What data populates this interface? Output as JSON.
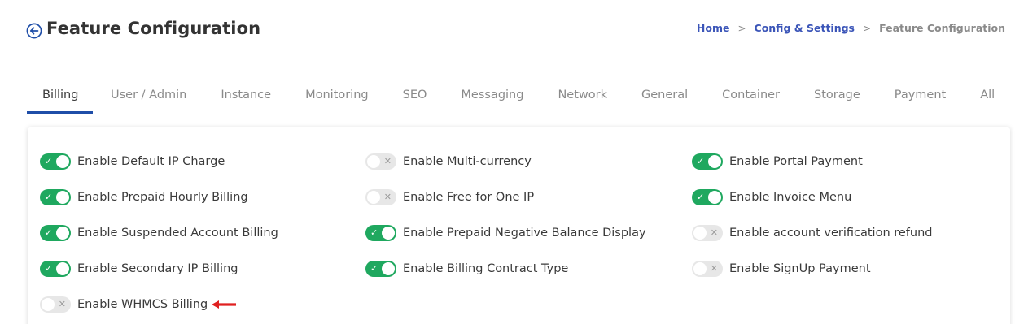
{
  "header": {
    "title": "Feature Configuration",
    "breadcrumb": {
      "home": "Home",
      "section": "Config & Settings",
      "current": "Feature Configuration",
      "separator": ">"
    }
  },
  "tabs": [
    {
      "label": "Billing",
      "active": true
    },
    {
      "label": "User / Admin",
      "active": false
    },
    {
      "label": "Instance",
      "active": false
    },
    {
      "label": "Monitoring",
      "active": false
    },
    {
      "label": "SEO",
      "active": false
    },
    {
      "label": "Messaging",
      "active": false
    },
    {
      "label": "Network",
      "active": false
    },
    {
      "label": "General",
      "active": false
    },
    {
      "label": "Container",
      "active": false
    },
    {
      "label": "Storage",
      "active": false
    },
    {
      "label": "Payment",
      "active": false
    },
    {
      "label": "All",
      "active": false
    }
  ],
  "settings": {
    "col1": [
      {
        "label": "Enable Default IP Charge",
        "enabled": true
      },
      {
        "label": "Enable Prepaid Hourly Billing",
        "enabled": true
      },
      {
        "label": "Enable Suspended Account Billing",
        "enabled": true
      },
      {
        "label": "Enable Secondary IP Billing",
        "enabled": true
      },
      {
        "label": "Enable WHMCS Billing",
        "enabled": false
      }
    ],
    "col2": [
      {
        "label": "Enable Multi-currency",
        "enabled": false
      },
      {
        "label": "Enable Free for One IP",
        "enabled": false
      },
      {
        "label": "Enable Prepaid Negative Balance Display",
        "enabled": true
      },
      {
        "label": "Enable Billing Contract Type",
        "enabled": true
      }
    ],
    "col3": [
      {
        "label": "Enable Portal Payment",
        "enabled": true
      },
      {
        "label": "Enable Invoice Menu",
        "enabled": true
      },
      {
        "label": "Enable account verification refund",
        "enabled": false
      },
      {
        "label": "Enable SignUp Payment",
        "enabled": false
      }
    ]
  },
  "toggle_marks": {
    "on": "✓",
    "off": "✕"
  },
  "colors": {
    "toggle_on": "#1fa85f",
    "toggle_off": "#e7e7e7",
    "link": "#3b55b8",
    "tab_underline": "#1f4ea8",
    "annotation_arrow": "#e02020"
  }
}
